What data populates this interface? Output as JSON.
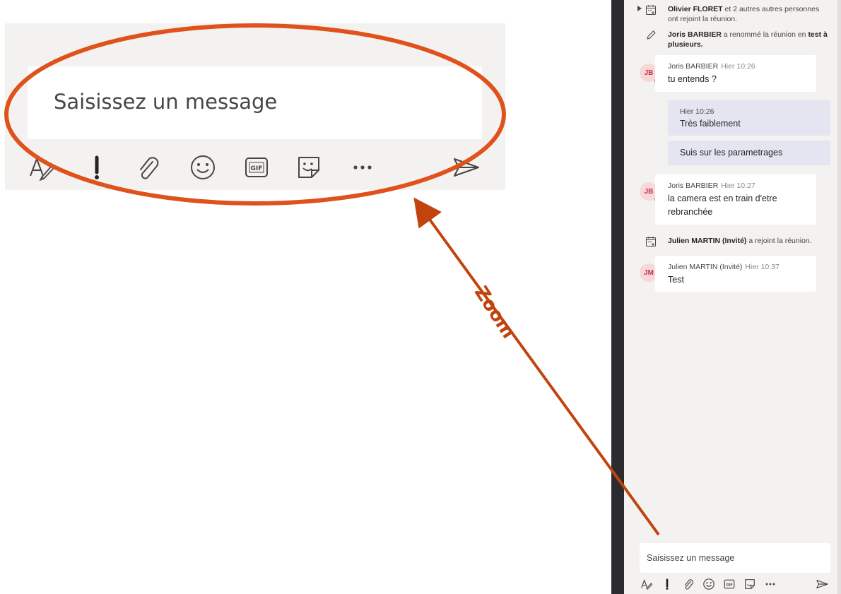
{
  "zoom": {
    "placeholder": "Saisissez un message",
    "label": "Zoom",
    "colors": {
      "ellipse": "#e0521c",
      "arrow": "#c1440e"
    },
    "toolbar": [
      "format-icon",
      "important-icon",
      "attach-icon",
      "emoji-icon",
      "gif-icon",
      "sticker-icon",
      "more-icon",
      "send-icon"
    ],
    "gif_text": "GIF"
  },
  "chat": {
    "events": [
      {
        "icon": "calendar-join-icon",
        "bold": "Olivier FLORET",
        "text": " et 2 autres autres personnes ont rejoint la réunion."
      },
      {
        "icon": "pencil-icon",
        "bold": "Joris BARBIER",
        "text": " a renommé la réunion en ",
        "bold2": "test à plusieurs."
      },
      {
        "icon": "calendar-join-icon",
        "bold": "Julien MARTIN (Invité)",
        "text": " a rejoint la réunion."
      }
    ],
    "messages": [
      {
        "initials": "JB",
        "author": "Joris BARBIER",
        "time": "Hier 10:26",
        "text": "tu entends ?"
      },
      {
        "initials": "JB",
        "author": "Joris BARBIER",
        "time": "Hier 10:27",
        "text": "la camera est en train d'etre rebranchée"
      },
      {
        "initials": "JM",
        "author": "Julien MARTIN (Invité)",
        "time": "Hier 10:37",
        "text": "Test"
      }
    ],
    "own_messages": [
      {
        "time": "Hier 10:26",
        "text": "Très faiblement"
      },
      {
        "text": "Suis sur les parametrages"
      }
    ],
    "composer": {
      "placeholder": "Saisissez un message",
      "gif_text": "GIF"
    },
    "colors": {
      "pane": "#f3f2f1",
      "own_bubble": "#e5e5f1",
      "avatar_bg": "#f8d7d7",
      "avatar_text": "#c4314b"
    }
  }
}
